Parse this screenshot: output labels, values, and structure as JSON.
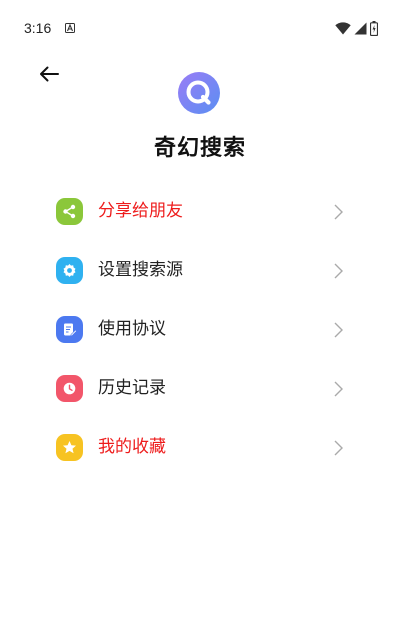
{
  "status_bar": {
    "time": "3:16"
  },
  "header": {
    "back_icon": "arrow-left-icon",
    "logo_icon": "search-logo-icon",
    "title": "奇幻搜索"
  },
  "menu": {
    "items": [
      {
        "label": "分享给朋友",
        "icon": "share-icon",
        "icon_color": "#8bc73a",
        "label_color": "#ee1c1c"
      },
      {
        "label": "设置搜索源",
        "icon": "settings-gear-icon",
        "icon_color": "#2fb1f0",
        "label_color": "#222222"
      },
      {
        "label": "使用协议",
        "icon": "document-edit-icon",
        "icon_color": "#4c79f0",
        "label_color": "#222222"
      },
      {
        "label": "历史记录",
        "icon": "clock-icon",
        "icon_color": "#f2566a",
        "label_color": "#222222"
      },
      {
        "label": "我的收藏",
        "icon": "star-icon",
        "icon_color": "#f7c322",
        "label_color": "#ee1c1c"
      }
    ]
  },
  "colors": {
    "logo_gradient_start": "#8c7cf5",
    "logo_gradient_end": "#5e8cf2",
    "accent_red": "#ee1c1c"
  }
}
